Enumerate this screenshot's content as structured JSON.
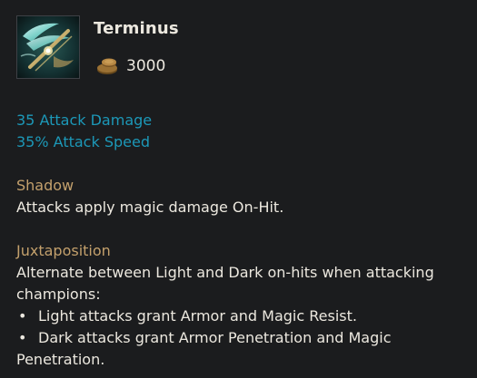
{
  "item": {
    "name": "Terminus",
    "icon": "crossbow-item-icon",
    "cost": "3000",
    "cost_icon": "gold-coins-icon"
  },
  "stats": [
    "35 Attack Damage",
    "35% Attack Speed"
  ],
  "passives": [
    {
      "name": "Shadow",
      "description": "Attacks apply magic damage On-Hit."
    },
    {
      "name": "Juxtaposition",
      "description_lines": [
        "Alternate between Light and Dark on-hits when attacking",
        "champions:"
      ],
      "bullets": [
        {
          "marker": "•",
          "lines": [
            "Light attacks grant Armor and Magic Resist."
          ]
        },
        {
          "marker": "•",
          "lines": [
            "Dark attacks grant Armor Penetration and Magic",
            "Penetration."
          ]
        }
      ]
    }
  ],
  "colors": {
    "background": "#1b1c1e",
    "title": "#ece8df",
    "stat": "#1c98b8",
    "passive_name": "#c3a06c",
    "body_text": "#ece8df"
  }
}
